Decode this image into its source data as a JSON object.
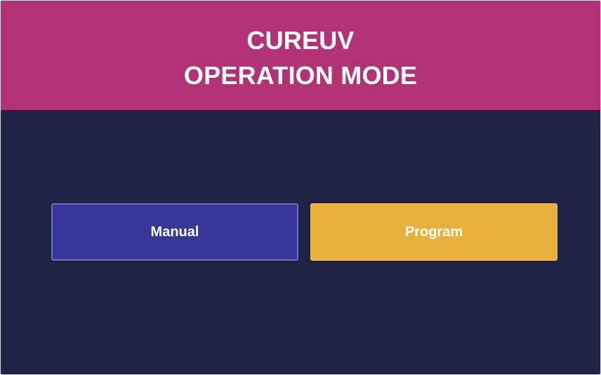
{
  "header": {
    "title_line1": "CUREUV",
    "title_line2": "OPERATION MODE"
  },
  "buttons": {
    "manual": "Manual",
    "program": "Program"
  },
  "colors": {
    "header_background": "#b23276",
    "screen_background": "#212345",
    "manual_button": "#37369b",
    "program_button": "#e8b13b"
  }
}
